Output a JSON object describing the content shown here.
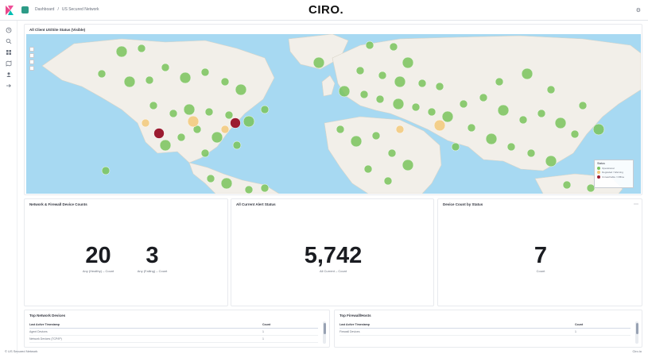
{
  "header": {
    "breadcrumbs": [
      "Dashboard",
      "US Secured Network"
    ],
    "logo_text": "CIRO."
  },
  "nav": {
    "icons": [
      "clock-icon",
      "search-icon",
      "grid-icon",
      "map-icon",
      "user-icon",
      "share-icon"
    ]
  },
  "map": {
    "title": "All Client US/Site Status (Visible)",
    "colors": {
      "water": "#a7d9f2",
      "land": "#f2efe9",
      "ok": "#7ac35c",
      "warn": "#f3c97a",
      "alert": "#9b1b30"
    },
    "legend": {
      "title": "Status",
      "items": [
        "Operational",
        "Degraded / Warning",
        "Unreachable / Offline"
      ]
    }
  },
  "metrics": {
    "p1": {
      "title": "Network & Firewall Device Counts",
      "values": [
        {
          "value": "20",
          "label": "Any (Healthy) – Count"
        },
        {
          "value": "3",
          "label": "Any (Failing) – Count"
        }
      ]
    },
    "p2": {
      "title": "All Current Alert Status",
      "value": "5,742",
      "label": "All Current – Count"
    },
    "p3": {
      "title": "Device Count by Status",
      "value": "7",
      "label": "Count"
    }
  },
  "tables": {
    "t1": {
      "title": "Top Network Devices",
      "headers": [
        "Last Active Timestamp",
        "Count"
      ],
      "rows": [
        [
          "Agent Devices",
          "1"
        ],
        [
          "Network Devices (TCP/IP)",
          "1"
        ]
      ]
    },
    "t2": {
      "title": "Top Firewall/Hosts",
      "headers": [
        "Last Active Timestamp",
        "Count"
      ],
      "rows": [
        [
          "Firewall Devices",
          "1"
        ]
      ]
    }
  },
  "footer": {
    "left": "© US Secured Network",
    "right": "Ciro.io"
  }
}
